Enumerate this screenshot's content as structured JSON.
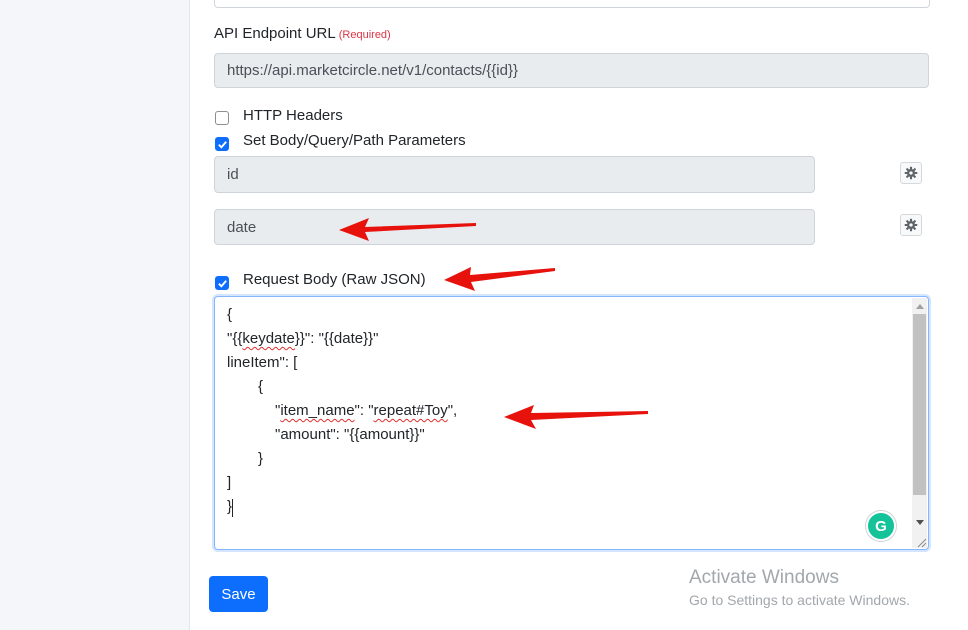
{
  "form": {
    "endpoint_label": "API Endpoint URL",
    "endpoint_required": "(Required)",
    "endpoint_value": "https://api.marketcircle.net/v1/contacts/{{id}}",
    "http_headers_label": "HTTP Headers",
    "http_headers_checked": false,
    "params_label": "Set Body/Query/Path Parameters",
    "params_checked": true,
    "params": [
      "id",
      "date"
    ],
    "raw_json_label": "Request Body (Raw JSON)",
    "raw_json_checked": true,
    "body_lines": [
      "{",
      "\"{{keydate}}\": \"{{date}}\"",
      "lineItem\": [",
      "    {",
      "        \"item_name\": \"repeat#Toy\",",
      "        \"amount\": \"{{amount}}\"",
      "    }",
      "]",
      "}"
    ],
    "save_label": "Save"
  },
  "grammarly": {
    "letter": "G",
    "color": "#15c39a"
  },
  "watermark": {
    "title": "Activate Windows",
    "subtitle": "Go to Settings to activate Windows."
  },
  "colors": {
    "primary": "#0d6efd",
    "required": "#dc3545",
    "annotation_arrow": "#e8120c"
  },
  "icons": [
    "checkbox-icon",
    "gear-icon",
    "scroll-up-icon",
    "scroll-down-icon",
    "resize-grip-icon",
    "grammarly-icon",
    "arrow-annotation"
  ]
}
